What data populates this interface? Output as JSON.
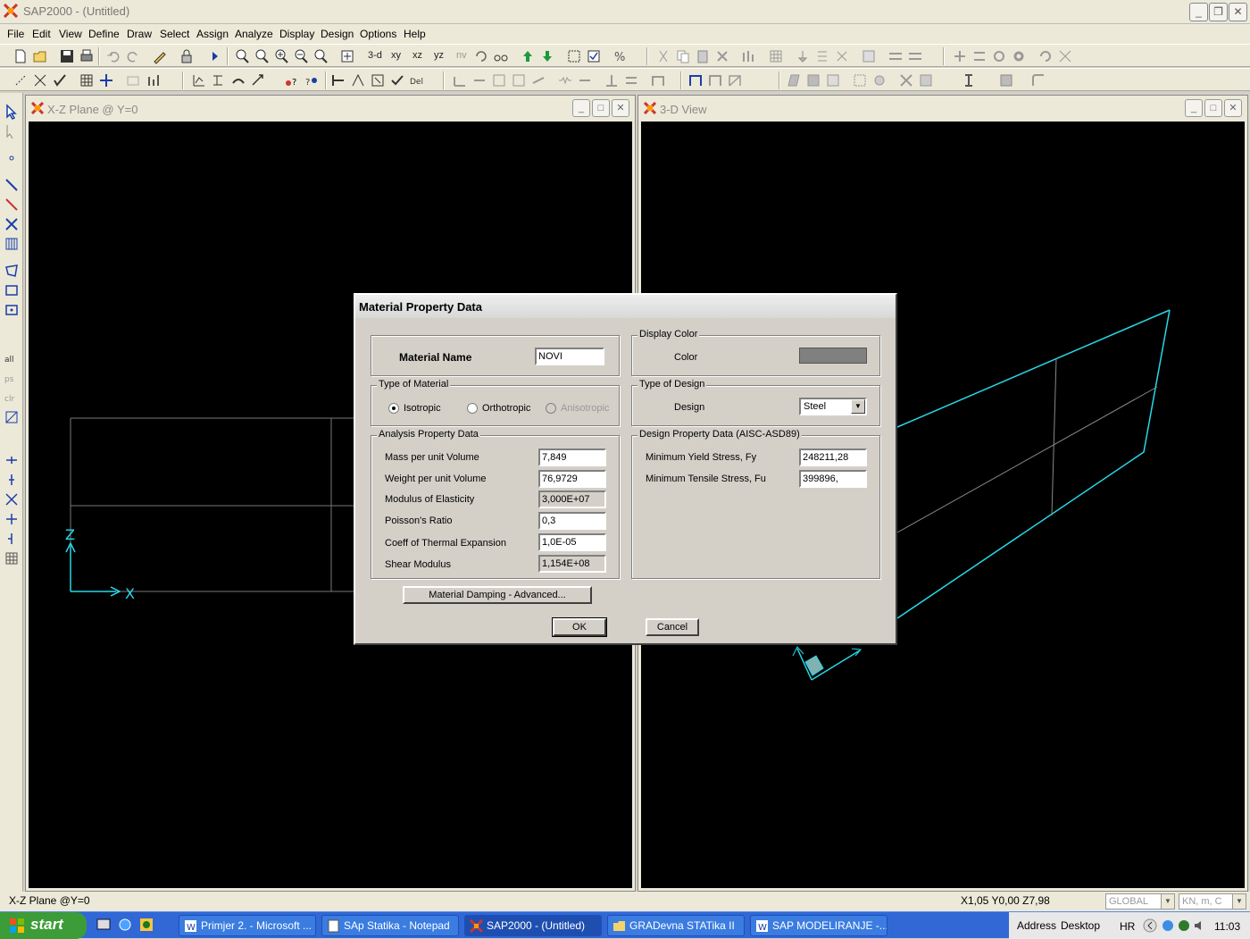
{
  "app": {
    "title": "SAP2000 - (Untitled)"
  },
  "menu": [
    "File",
    "Edit",
    "View",
    "Define",
    "Draw",
    "Select",
    "Assign",
    "Analyze",
    "Display",
    "Design",
    "Options",
    "Help"
  ],
  "toolbar": {
    "view_buttons": [
      "3-d",
      "xy",
      "xz",
      "yz",
      "nv"
    ]
  },
  "windows": {
    "left": {
      "title": "X-Z Plane @ Y=0",
      "axis_z": "Z",
      "axis_x": "X"
    },
    "right": {
      "title": "3-D View"
    }
  },
  "dialog": {
    "title": "Material Property Data",
    "material_name_label": "Material Name",
    "material_name_value": "NOVI",
    "display_color": {
      "legend": "Display Color",
      "label": "Color",
      "color": "#808080"
    },
    "type_of_material": {
      "legend": "Type of Material",
      "options": [
        "Isotropic",
        "Orthotropic",
        "Anisotropic"
      ],
      "selected": "Isotropic"
    },
    "type_of_design": {
      "legend": "Type of Design",
      "label": "Design",
      "value": "Steel"
    },
    "analysis": {
      "legend": "Analysis Property Data",
      "rows": [
        {
          "label": "Mass per unit Volume",
          "value": "7,849"
        },
        {
          "label": "Weight per unit Volume",
          "value": "76,9729"
        },
        {
          "label": "Modulus of Elasticity",
          "value": "3,000E+07"
        },
        {
          "label": "Poisson's Ratio",
          "value": "0,3"
        },
        {
          "label": "Coeff of Thermal Expansion",
          "value": "1,0E-05"
        },
        {
          "label": "Shear Modulus",
          "value": "1,154E+08"
        }
      ]
    },
    "design": {
      "legend": "Design Property Data (AISC-ASD89)",
      "rows": [
        {
          "label": "Minimum Yield Stress, Fy",
          "value": "248211,28"
        },
        {
          "label": "Minimum Tensile Stress, Fu",
          "value": "399896,"
        }
      ]
    },
    "damping_button": "Material Damping - Advanced...",
    "ok_button": "OK",
    "cancel_button": "Cancel"
  },
  "status": {
    "left": "X-Z Plane @Y=0",
    "coords": "X1,05  Y0,00  Z7,98",
    "coord_system": "GLOBAL",
    "units": "KN, m, C"
  },
  "taskbar": {
    "start": "start",
    "tasks": [
      {
        "label": "Primjer 2. - Microsoft ..."
      },
      {
        "label": "SAp Statika - Notepad"
      },
      {
        "label": "SAP2000 - (Untitled)"
      },
      {
        "label": "GRADevna  STATika  II"
      },
      {
        "label": "SAP  MODELIRANJE -..."
      }
    ],
    "address_label": "Address",
    "desktop_label": "Desktop",
    "language": "HR",
    "clock": "11:03"
  }
}
